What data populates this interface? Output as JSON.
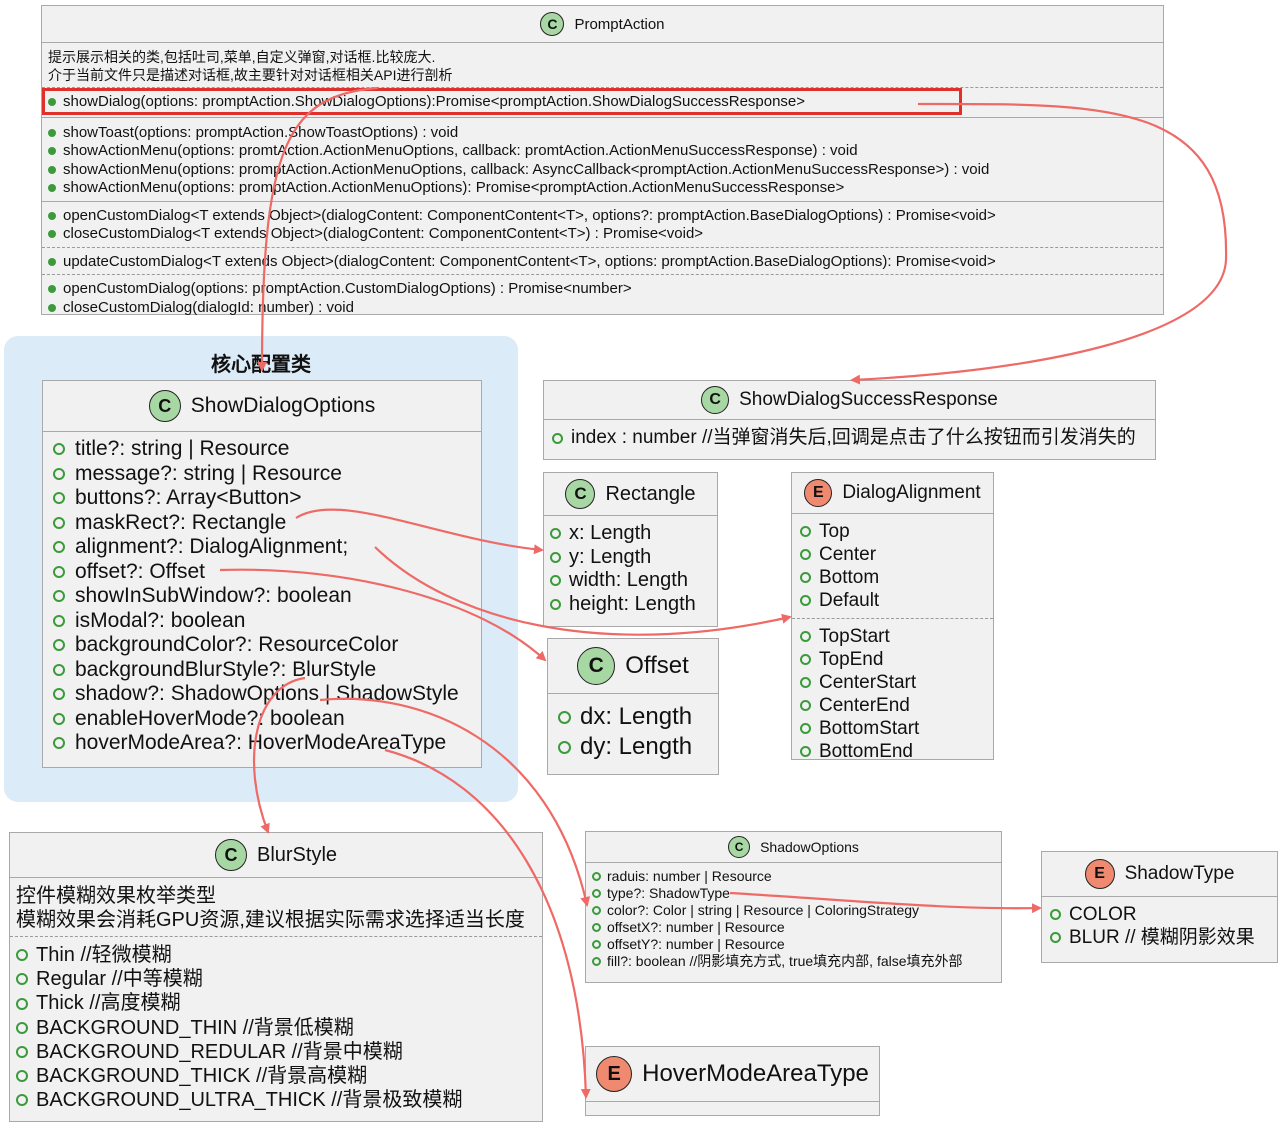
{
  "colors": {
    "class_badge": "#a7d8a3",
    "enum_badge": "#ef8a70",
    "arrow": "#ee6a66",
    "highlight": "#e0302b",
    "group_bg": "#dcebf8",
    "member_icon": "#3b9b3b"
  },
  "group": {
    "title": "核心配置类"
  },
  "prompt_action": {
    "badge": "C",
    "name": "PromptAction",
    "desc": [
      "提示展示相关的类,包括吐司,菜单,自定义弹窗,对话框.比较庞大.",
      "介于当前文件只是描述对话框,故主要针对对话框相关API进行剖析"
    ],
    "sections": [
      [
        "showDialog(options: promptAction.ShowDialogOptions):Promise<promptAction.ShowDialogSuccessResponse>"
      ],
      [
        "showToast(options: promptAction.ShowToastOptions) : void",
        "showActionMenu(options: promtAction.ActionMenuOptions, callback: promtAction.ActionMenuSuccessResponse) : void",
        "showActionMenu(options: promptAction.ActionMenuOptions, callback: AsyncCallback<promptAction.ActionMenuSuccessResponse>) : void",
        "showActionMenu(options: promptAction.ActionMenuOptions): Promise<promptAction.ActionMenuSuccessResponse>"
      ],
      [
        "openCustomDialog<T extends Object>(dialogContent: ComponentContent<T>, options?: promptAction.BaseDialogOptions) : Promise<void>",
        "closeCustomDialog<T extends Object>(dialogContent: ComponentContent<T>) : Promise<void>"
      ],
      [
        "updateCustomDialog<T extends Object>(dialogContent: ComponentContent<T>, options: promptAction.BaseDialogOptions): Promise<void>"
      ],
      [
        "openCustomDialog(options: promptAction.CustomDialogOptions) : Promise<number>",
        "closeCustomDialog(dialogId: number) : void"
      ]
    ]
  },
  "show_dialog_options": {
    "badge": "C",
    "name": "ShowDialogOptions",
    "fields": [
      "title?: string | Resource",
      "message?: string | Resource",
      "buttons?: Array<Button>",
      "maskRect?: Rectangle",
      "alignment?: DialogAlignment;",
      "offset?: Offset",
      "showInSubWindow?: boolean",
      "isModal?: boolean",
      "backgroundColor?: ResourceColor",
      "backgroundBlurStyle?: BlurStyle",
      "shadow?: ShadowOptions | ShadowStyle",
      "enableHoverMode?: boolean",
      "hoverModeArea?: HoverModeAreaType"
    ]
  },
  "show_dialog_success_response": {
    "badge": "C",
    "name": "ShowDialogSuccessResponse",
    "fields": [
      "index : number //当弹窗消失后,回调是点击了什么按钮而引发消失的"
    ]
  },
  "rectangle": {
    "badge": "C",
    "name": "Rectangle",
    "fields": [
      "x: Length",
      "y: Length",
      "width: Length",
      "height: Length"
    ]
  },
  "offset": {
    "badge": "C",
    "name": "Offset",
    "fields": [
      "dx: Length",
      "dy: Length"
    ]
  },
  "dialog_alignment": {
    "badge": "E",
    "name": "DialogAlignment",
    "sections": [
      [
        "Top",
        "Center",
        "Bottom",
        "Default"
      ],
      [
        "TopStart",
        "TopEnd",
        "CenterStart",
        "CenterEnd",
        "BottomStart",
        "BottomEnd"
      ]
    ]
  },
  "blur_style": {
    "badge": "C",
    "name": "BlurStyle",
    "desc": [
      "控件模糊效果枚举类型",
      "模糊效果会消耗GPU资源,建议根据实际需求选择适当长度"
    ],
    "fields": [
      "Thin //轻微模糊",
      "Regular //中等模糊",
      "Thick //高度模糊",
      "BACKGROUND_THIN //背景低模糊",
      "BACKGROUND_REDULAR //背景中模糊",
      "BACKGROUND_THICK //背景高模糊",
      "BACKGROUND_ULTRA_THICK //背景极致模糊"
    ]
  },
  "shadow_options": {
    "badge": "C",
    "name": "ShadowOptions",
    "fields": [
      "raduis: number | Resource",
      "type?: ShadowType",
      "color?: Color | string | Resource | ColoringStrategy",
      "offsetX?: number | Resource",
      "offsetY?: number | Resource",
      "fill?: boolean //阴影填充方式, true填充内部, false填充外部"
    ]
  },
  "shadow_type": {
    "badge": "E",
    "name": "ShadowType",
    "fields": [
      "COLOR",
      "BLUR // 模糊阴影效果"
    ]
  },
  "hover_mode_area_type": {
    "badge": "E",
    "name": "HoverModeAreaType"
  }
}
